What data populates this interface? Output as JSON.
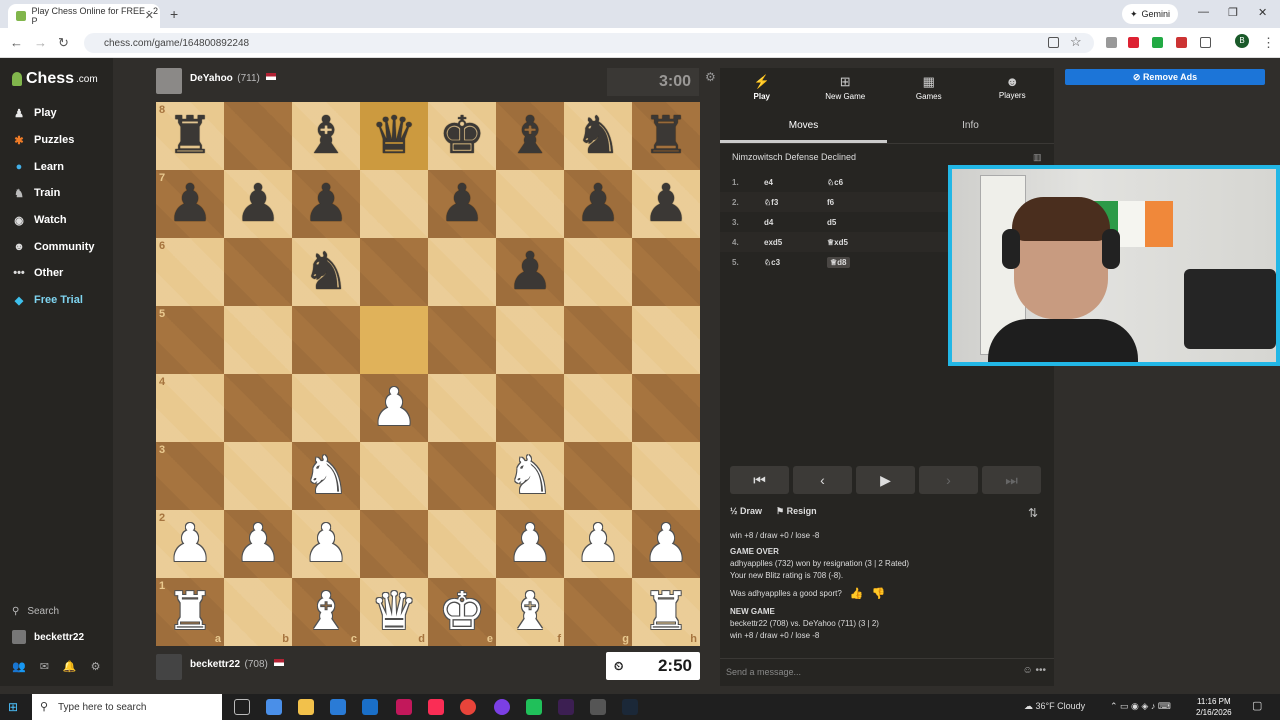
{
  "browser": {
    "tab_title": "Play Chess Online for FREE - 2 P",
    "url": "chess.com/game/164800892248",
    "gemini_label": "Gemini",
    "profile_initial": "B"
  },
  "sidebar": {
    "logo": "Chess",
    "logo_suffix": ".com",
    "items": [
      {
        "label": "Play",
        "icon": "play-pawn-icon"
      },
      {
        "label": "Puzzles",
        "icon": "puzzle-icon"
      },
      {
        "label": "Learn",
        "icon": "learn-icon"
      },
      {
        "label": "Train",
        "icon": "train-icon"
      },
      {
        "label": "Watch",
        "icon": "watch-icon"
      },
      {
        "label": "Community",
        "icon": "community-icon"
      },
      {
        "label": "Other",
        "icon": "more-icon"
      },
      {
        "label": "Free Trial",
        "icon": "diamond-icon"
      }
    ],
    "search_label": "Search",
    "username": "beckettr22"
  },
  "game": {
    "top_player": {
      "name": "DeYahoo",
      "rating": "(711)",
      "clock": "3:00"
    },
    "bottom_player": {
      "name": "beckettr22",
      "rating": "(708)",
      "clock": "2:50"
    },
    "board": [
      [
        "br",
        "",
        "bb",
        "bq",
        "bk",
        "bb",
        "bn",
        "br"
      ],
      [
        "bp",
        "bp",
        "bp",
        "",
        "bp",
        "",
        "bp",
        "bp"
      ],
      [
        "",
        "",
        "bn",
        "",
        "",
        "bp",
        "",
        ""
      ],
      [
        "",
        "",
        "",
        "",
        "",
        "",
        "",
        ""
      ],
      [
        "",
        "",
        "",
        "wp",
        "",
        "",
        "",
        ""
      ],
      [
        "",
        "",
        "wn",
        "",
        "",
        "wn",
        "",
        ""
      ],
      [
        "wp",
        "wp",
        "wp",
        "",
        "",
        "wp",
        "wp",
        "wp"
      ],
      [
        "wr",
        "",
        "wb",
        "wq",
        "wk",
        "wb",
        "",
        "wr"
      ]
    ],
    "highlights": [
      "d8",
      "d5"
    ],
    "ranks": [
      "8",
      "7",
      "6",
      "5",
      "4",
      "3",
      "2",
      "1"
    ],
    "files": [
      "a",
      "b",
      "c",
      "d",
      "e",
      "f",
      "g",
      "h"
    ]
  },
  "panel": {
    "tabs": [
      {
        "label": "Play",
        "icon": "lightning-icon"
      },
      {
        "label": "New Game",
        "icon": "plus-icon"
      },
      {
        "label": "Games",
        "icon": "games-icon"
      },
      {
        "label": "Players",
        "icon": "players-icon"
      }
    ],
    "subtabs": [
      "Moves",
      "Info"
    ],
    "opening": "Nimzowitsch Defense Declined",
    "moves": [
      {
        "num": "1.",
        "white": "e4",
        "black": "♘c6"
      },
      {
        "num": "2.",
        "white": "♘f3",
        "black": "f6"
      },
      {
        "num": "3.",
        "white": "d4",
        "black": "d5"
      },
      {
        "num": "4.",
        "white": "exd5",
        "black": "♕xd5"
      },
      {
        "num": "5.",
        "white": "♘c3",
        "black": "♕d8"
      }
    ],
    "draw_label": "Draw",
    "resign_label": "Resign",
    "log": {
      "line0": "win +8 / draw +0 / lose -8",
      "game_over_title": "GAME OVER",
      "game_over_line1": "adhyapplles (732) won by resignation (3 | 2 Rated)",
      "game_over_line2": "Your new Blitz rating is 708 (-8).",
      "sport_q": "Was adhyapplles a good sport?",
      "new_game_title": "NEW GAME",
      "new_game_line1": "beckettr22 (708) vs. DeYahoo (711) (3 | 2)",
      "new_game_line2": "win +8 / draw +0 / lose -8"
    },
    "chat_placeholder": "Send a message..."
  },
  "ad": {
    "remove_label": "Remove Ads"
  },
  "taskbar": {
    "search_placeholder": "Type here to search",
    "weather": "36°F  Cloudy",
    "time": "11:16 PM",
    "date": "2/16/2026"
  }
}
